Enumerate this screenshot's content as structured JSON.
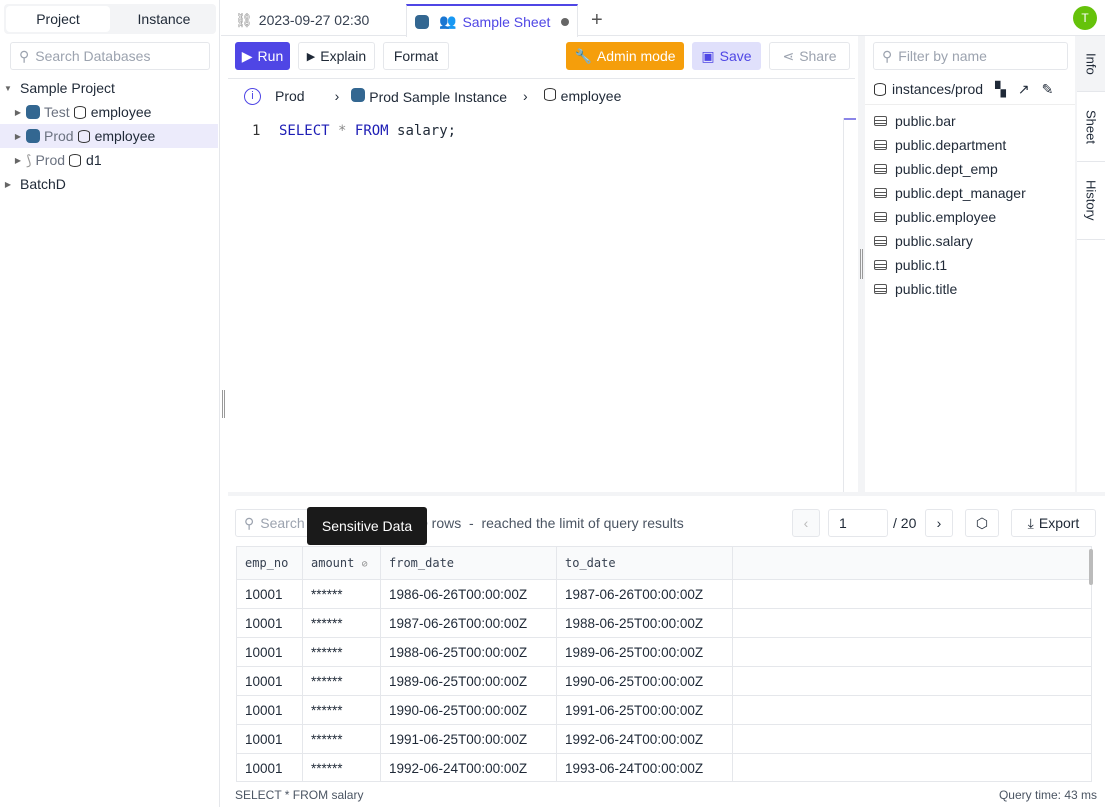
{
  "sidebar": {
    "tabs": [
      "Project",
      "Instance"
    ],
    "search_placeholder": "Search Databases",
    "tree": [
      {
        "label": "Sample Project"
      },
      {
        "env": "Test",
        "db": "employee"
      },
      {
        "env": "Prod",
        "db": "employee"
      },
      {
        "env": "Prod",
        "db": "d1"
      },
      {
        "label": "BatchD"
      }
    ]
  },
  "tabs": [
    {
      "label": "2023-09-27 02:30"
    },
    {
      "label": "Sample Sheet"
    }
  ],
  "avatar": "T",
  "toolbar": {
    "run": "Run",
    "explain": "Explain",
    "format": "Format",
    "admin": "Admin mode",
    "save": "Save",
    "share": "Share"
  },
  "breadcrumb": {
    "env": "Prod",
    "instance": "Prod Sample Instance",
    "database": "employee"
  },
  "editor": {
    "line": "1",
    "kw1": "SELECT",
    "star": "*",
    "kw2": "FROM",
    "rest": "salary;"
  },
  "schema": {
    "filter_placeholder": "Filter by name",
    "path": "instances/prod",
    "tables": [
      "public.bar",
      "public.department",
      "public.dept_emp",
      "public.dept_manager",
      "public.employee",
      "public.salary",
      "public.t1",
      "public.title"
    ]
  },
  "side_tabs": [
    "Info",
    "Sheet",
    "History"
  ],
  "results": {
    "search_placeholder": "Search",
    "summary": "0 rows  -  reached the limit of query results",
    "tooltip": "Sensitive Data",
    "page": "1",
    "total_pages": "/ 20",
    "export": "Export",
    "columns": [
      "emp_no",
      "amount",
      "from_date",
      "to_date"
    ],
    "rows": [
      [
        "10001",
        "******",
        "1986-06-26T00:00:00Z",
        "1987-06-26T00:00:00Z"
      ],
      [
        "10001",
        "******",
        "1987-06-26T00:00:00Z",
        "1988-06-25T00:00:00Z"
      ],
      [
        "10001",
        "******",
        "1988-06-25T00:00:00Z",
        "1989-06-25T00:00:00Z"
      ],
      [
        "10001",
        "******",
        "1989-06-25T00:00:00Z",
        "1990-06-25T00:00:00Z"
      ],
      [
        "10001",
        "******",
        "1990-06-25T00:00:00Z",
        "1991-06-25T00:00:00Z"
      ],
      [
        "10001",
        "******",
        "1991-06-25T00:00:00Z",
        "1992-06-24T00:00:00Z"
      ],
      [
        "10001",
        "******",
        "1992-06-24T00:00:00Z",
        "1993-06-24T00:00:00Z"
      ]
    ]
  },
  "status": {
    "query": "SELECT * FROM salary",
    "time": "Query time: 43 ms"
  },
  "colors": {
    "accent": "#4f46e5",
    "admin": "#f59e0b",
    "avatar": "#65c20a"
  }
}
